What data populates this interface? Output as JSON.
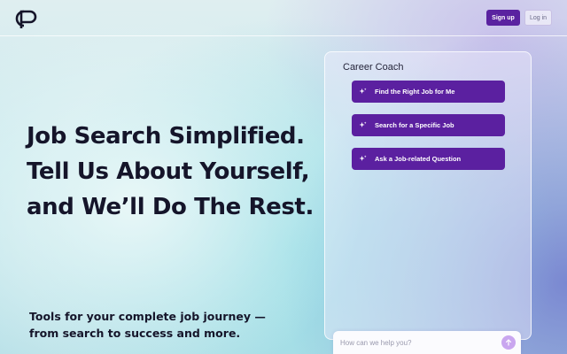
{
  "header": {
    "logo_icon": "cp-logo-icon",
    "signup_label": "Sign up",
    "login_label": "Log in"
  },
  "hero": {
    "title_lines": [
      "Job Search Simplified.",
      "Tell Us About Yourself,",
      "and We’ll Do The Rest."
    ],
    "subtitle_lines": [
      "Tools for your complete job journey —",
      "from search to success and more."
    ]
  },
  "coach": {
    "title": "Career Coach",
    "options": [
      {
        "label": "Find the Right Job for Me",
        "icon": "sparkle-icon"
      },
      {
        "label": "Search for a Specific Job",
        "icon": "sparkle-icon"
      },
      {
        "label": "Ask a Job-related Question",
        "icon": "sparkle-icon"
      }
    ],
    "input_placeholder": "How can we help you?",
    "send_icon": "arrow-up-icon"
  },
  "colors": {
    "accent": "#5b20a0",
    "text": "#15152a",
    "send_button": "#c9a6ef"
  }
}
